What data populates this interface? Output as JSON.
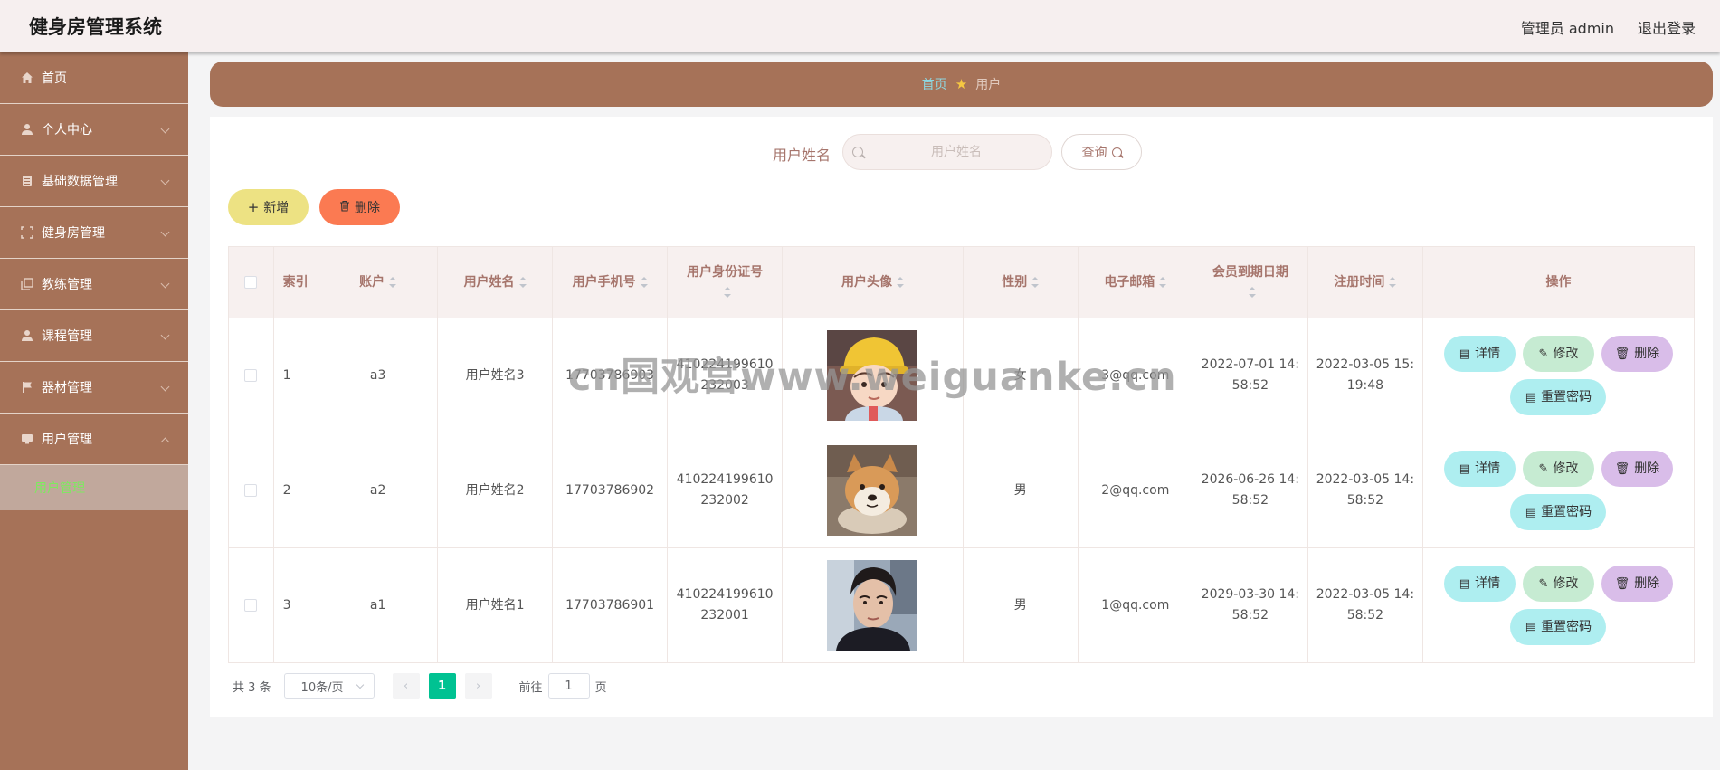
{
  "header": {
    "title": "健身房管理系统",
    "admin_label": "管理员 admin",
    "logout_label": "退出登录"
  },
  "sidebar": {
    "items": [
      {
        "label": "首页",
        "icon": "home-icon"
      },
      {
        "label": "个人中心",
        "icon": "user-icon"
      },
      {
        "label": "基础数据管理",
        "icon": "database-icon"
      },
      {
        "label": "健身房管理",
        "icon": "fullscreen-icon"
      },
      {
        "label": "教练管理",
        "icon": "copy-icon"
      },
      {
        "label": "课程管理",
        "icon": "user-icon"
      },
      {
        "label": "器材管理",
        "icon": "flag-icon"
      },
      {
        "label": "用户管理",
        "icon": "monitor-icon"
      }
    ],
    "active_submenu": "用户管理"
  },
  "breadcrumb": {
    "home": "首页",
    "current": "用户"
  },
  "search": {
    "label": "用户姓名",
    "placeholder": "用户姓名",
    "value": "",
    "query_label": "查询"
  },
  "toolbar": {
    "add_label": "新增",
    "delete_label": "删除"
  },
  "table": {
    "headers": {
      "index": "索引",
      "account": "账户",
      "name": "用户姓名",
      "phone": "用户手机号",
      "id_card": "用户身份证号",
      "avatar": "用户头像",
      "gender": "性别",
      "email": "电子邮箱",
      "expire": "会员到期日期",
      "register": "注册时间",
      "ops": "操作"
    },
    "rows": [
      {
        "index": "1",
        "account": "a3",
        "name": "用户姓名3",
        "phone": "17703786903",
        "id_card_1": "410224199610",
        "id_card_2": "232003",
        "gender": "女",
        "email": "3@qq.com",
        "expire_1": "2022-07-01 14:",
        "expire_2": "58:52",
        "register_1": "2022-03-05 15:",
        "register_2": "19:48",
        "avatar": "cartoon-avatar"
      },
      {
        "index": "2",
        "account": "a2",
        "name": "用户姓名2",
        "phone": "17703786902",
        "id_card_1": "410224199610",
        "id_card_2": "232002",
        "gender": "男",
        "email": "2@qq.com",
        "expire_1": "2026-06-26 14:",
        "expire_2": "58:52",
        "register_1": "2022-03-05 14:",
        "register_2": "58:52",
        "avatar": "dog-avatar"
      },
      {
        "index": "3",
        "account": "a1",
        "name": "用户姓名1",
        "phone": "17703786901",
        "id_card_1": "410224199610",
        "id_card_2": "232001",
        "gender": "男",
        "email": "1@qq.com",
        "expire_1": "2029-03-30 14:",
        "expire_2": "58:52",
        "register_1": "2022-03-05 14:",
        "register_2": "58:52",
        "avatar": "man-photo-avatar"
      }
    ],
    "ops": {
      "detail": "详情",
      "edit": "修改",
      "delete": "删除",
      "reset": "重置密码"
    }
  },
  "pagination": {
    "total": "共 3 条",
    "page_size": "10条/页",
    "current_page": "1",
    "goto_label": "前往",
    "jump_value": "1",
    "unit": "页"
  },
  "watermark": "cn国观宫www.weiguanke.cn",
  "colors": {
    "sidebar_bg": "#a67258",
    "header_bg": "#f6efef",
    "accent_green": "#00c292",
    "add_btn": "#ede283",
    "delete_btn": "#fb7a52",
    "detail_btn": "#aeeef0",
    "edit_btn": "#c6ebd2",
    "op_delete_btn": "#d9bde9"
  }
}
